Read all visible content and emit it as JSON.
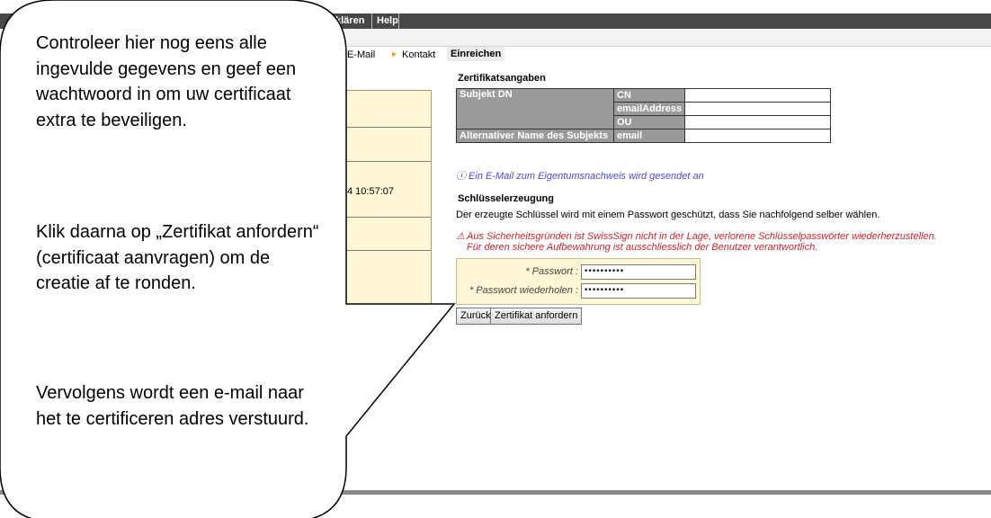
{
  "menu": {
    "items": [
      "klären",
      "Help"
    ]
  },
  "breadcrumb": {
    "items": [
      "E-Mail",
      "Kontakt"
    ],
    "active": "Einreichen"
  },
  "left_panel": {
    "timestamp": "4 10:57:07"
  },
  "cert": {
    "title": "Zertifikatsangaben",
    "subject_label": "Subjekt DN",
    "alt_label": "Alternativer Name des Subjekts",
    "fields": [
      "CN",
      "emailAddress",
      "OU",
      "email"
    ],
    "info": "ⓘ Ein E-Mail zum Eigentumsnachweis wird gesendet an"
  },
  "keygen": {
    "title": "Schlüsselerzeugung",
    "desc": "Der erzeugte Schlüssel wird mit einem Passwort geschützt, dass Sie nachfolgend selber wählen.",
    "warn1": "Aus Sicherheitsgründen ist SwissSign nicht in der Lage, verlorene Schlüsselpasswörter wiederherzustellen.",
    "warn2": "Für deren sichere Aufbewahrung ist ausschliesslich der Benutzer verantwortlich.",
    "pw_label": "* Passwort :",
    "pw_repeat_label": "* Passwort wiederholen :",
    "pw_value": "••••••••••",
    "pw_repeat_value": "••••••••••"
  },
  "buttons": {
    "back": "Zurück",
    "request": "Zertifikat anfordern"
  },
  "callout": {
    "p1": "Controleer hier nog eens alle ingevulde gegevens en geef een wachtwoord in om uw certificaat extra te beveiligen.",
    "p2": "Klik daarna op „Zertifikat anfordern“ (certificaat aanvragen) om de creatie af te ronden.",
    "p3": "Vervolgens wordt een e-mail naar het te certificeren adres verstuurd."
  }
}
